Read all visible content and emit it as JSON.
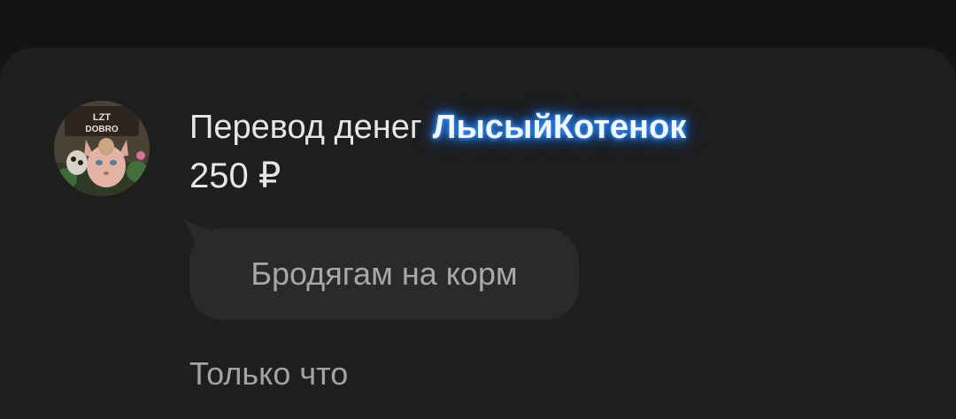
{
  "donation": {
    "avatar_icon": "cat-avatar-icon",
    "avatar_caption": "LZT DOBRO",
    "title_prefix": "Перевод денег",
    "sender_name": "ЛысыйКотенок",
    "amount": "250 ₽",
    "message": "Бродягам на корм",
    "timestamp": "Только что"
  },
  "colors": {
    "background": "#141414",
    "card": "#1e1e1e",
    "bubble": "#2a2a2a",
    "name_glow": "#2f8cff"
  }
}
